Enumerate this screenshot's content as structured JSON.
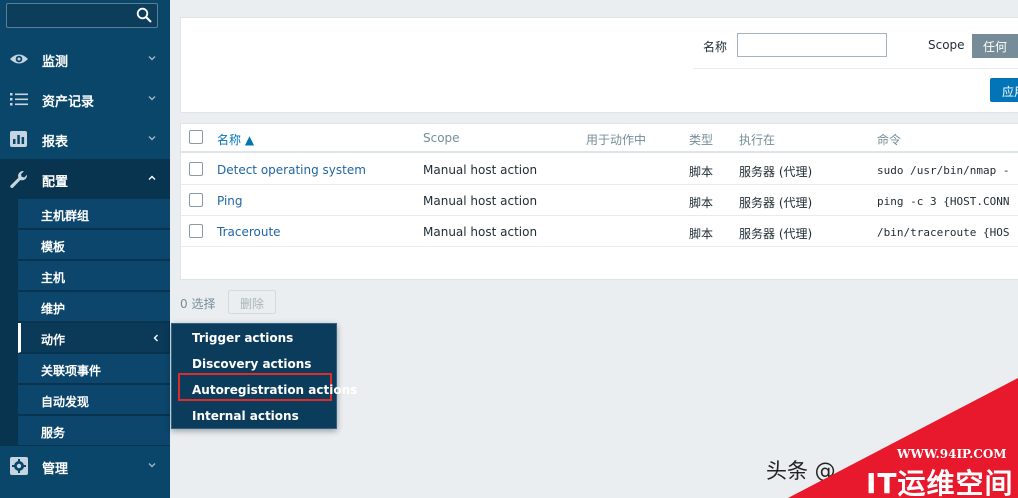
{
  "sidebar": {
    "search_value": "",
    "nav": [
      {
        "label": "监测",
        "icon": "eye-icon"
      },
      {
        "label": "资产记录",
        "icon": "list-icon"
      },
      {
        "label": "报表",
        "icon": "bar-chart-icon"
      },
      {
        "label": "配置",
        "icon": "wrench-icon"
      },
      {
        "label": "管理",
        "icon": "gear-icon"
      }
    ],
    "config_submenu": [
      "主机群组",
      "模板",
      "主机",
      "维护",
      "动作",
      "关联项事件",
      "自动发现",
      "服务"
    ]
  },
  "filter": {
    "name_label": "名称",
    "name_value": "",
    "scope_label": "Scope",
    "scope_selected": "任何",
    "apply_label": "应用"
  },
  "table": {
    "headers": {
      "name": "名称 ▲",
      "scope": "Scope",
      "used_in_actions": "用于动作中",
      "type": "类型",
      "execute_on": "执行在",
      "command": "命令"
    },
    "rows": [
      {
        "name": "Detect operating system",
        "scope": "Manual host action",
        "used": "",
        "type": "脚本",
        "execute_on": "服务器 (代理)",
        "command": "sudo /usr/bin/nmap -"
      },
      {
        "name": "Ping",
        "scope": "Manual host action",
        "used": "",
        "type": "脚本",
        "execute_on": "服务器 (代理)",
        "command": "ping -c 3 {HOST.CONN"
      },
      {
        "name": "Traceroute",
        "scope": "Manual host action",
        "used": "",
        "type": "脚本",
        "execute_on": "服务器 (代理)",
        "command": "/bin/traceroute {HOS"
      }
    ]
  },
  "footer": {
    "selected_count": "0 选择",
    "delete_label": "删除"
  },
  "popup_menu": [
    "Trigger actions",
    "Discovery actions",
    "Autoregistration actions",
    "Internal actions"
  ],
  "watermark": {
    "toutiao": "头条 @",
    "url": "WWW.94IP.COM",
    "brand": "IT运维空间"
  },
  "colors": {
    "sidebar_bg": "#0a466a",
    "link": "#1f65a6",
    "primary_button": "#0275b8",
    "highlight": "#e02b2b",
    "watermark_red": "#e8192c"
  }
}
